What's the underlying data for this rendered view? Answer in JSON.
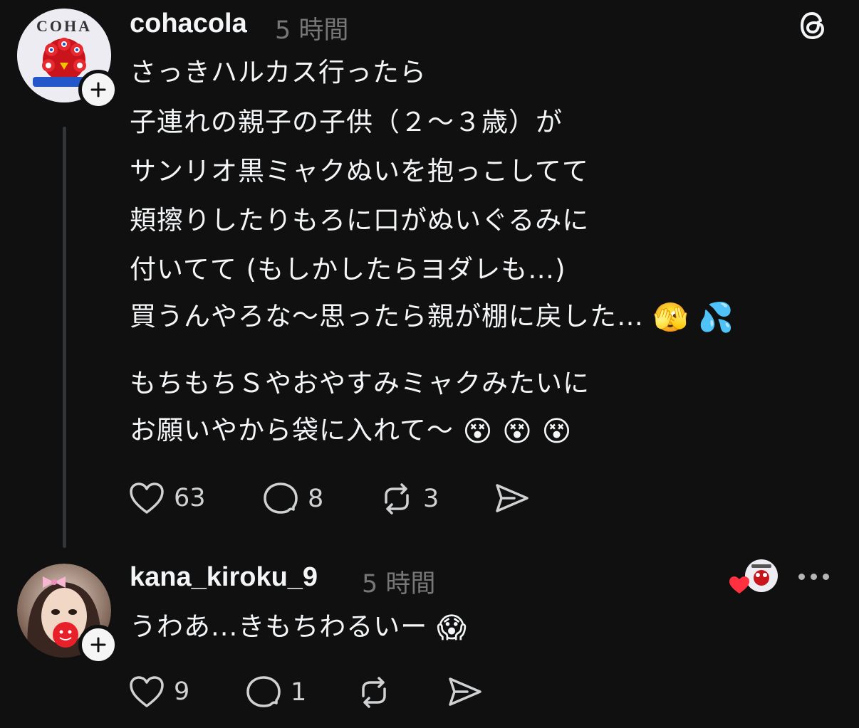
{
  "post": {
    "username": "cohacola",
    "time": "5 時間",
    "lines": [
      "さっきハルカス行ったら",
      "子連れの親子の子供（２〜３歳）が",
      "サンリオ黒ミャクぬいを抱っこしてて",
      "頬擦りしたりもろに口がぬいぐるみに",
      "付いてて (もしかしたらヨダレも…)",
      "買うんやろな〜思ったら親が棚に戻した…",
      "もちもちＳやおやすみミャクみたいに",
      "お願いやから袋に入れて〜"
    ],
    "emoji_line6": [
      "🫣",
      "💦"
    ],
    "emoji_line8": [
      "😵",
      "😵",
      "😵"
    ],
    "likes": "63",
    "replies": "8",
    "reposts": "3",
    "avatar_text": "COHA"
  },
  "reply": {
    "username": "kana_kiroku_9",
    "time": "5 時間",
    "text": "うわあ...きもちわるいー",
    "emoji": "😱",
    "likes": "9",
    "replies": "1"
  },
  "icons": {
    "app": "threads-icon",
    "like": "heart-icon",
    "reply": "speech-bubble-icon",
    "repost": "repost-icon",
    "share": "send-icon",
    "more": "more-dots-icon",
    "follow": "plus-icon",
    "liked_by_author": "red-heart-icon"
  },
  "colors": {
    "background": "#101010",
    "text": "#f3f5f7",
    "muted": "#777777",
    "heart": "#ff3040"
  }
}
